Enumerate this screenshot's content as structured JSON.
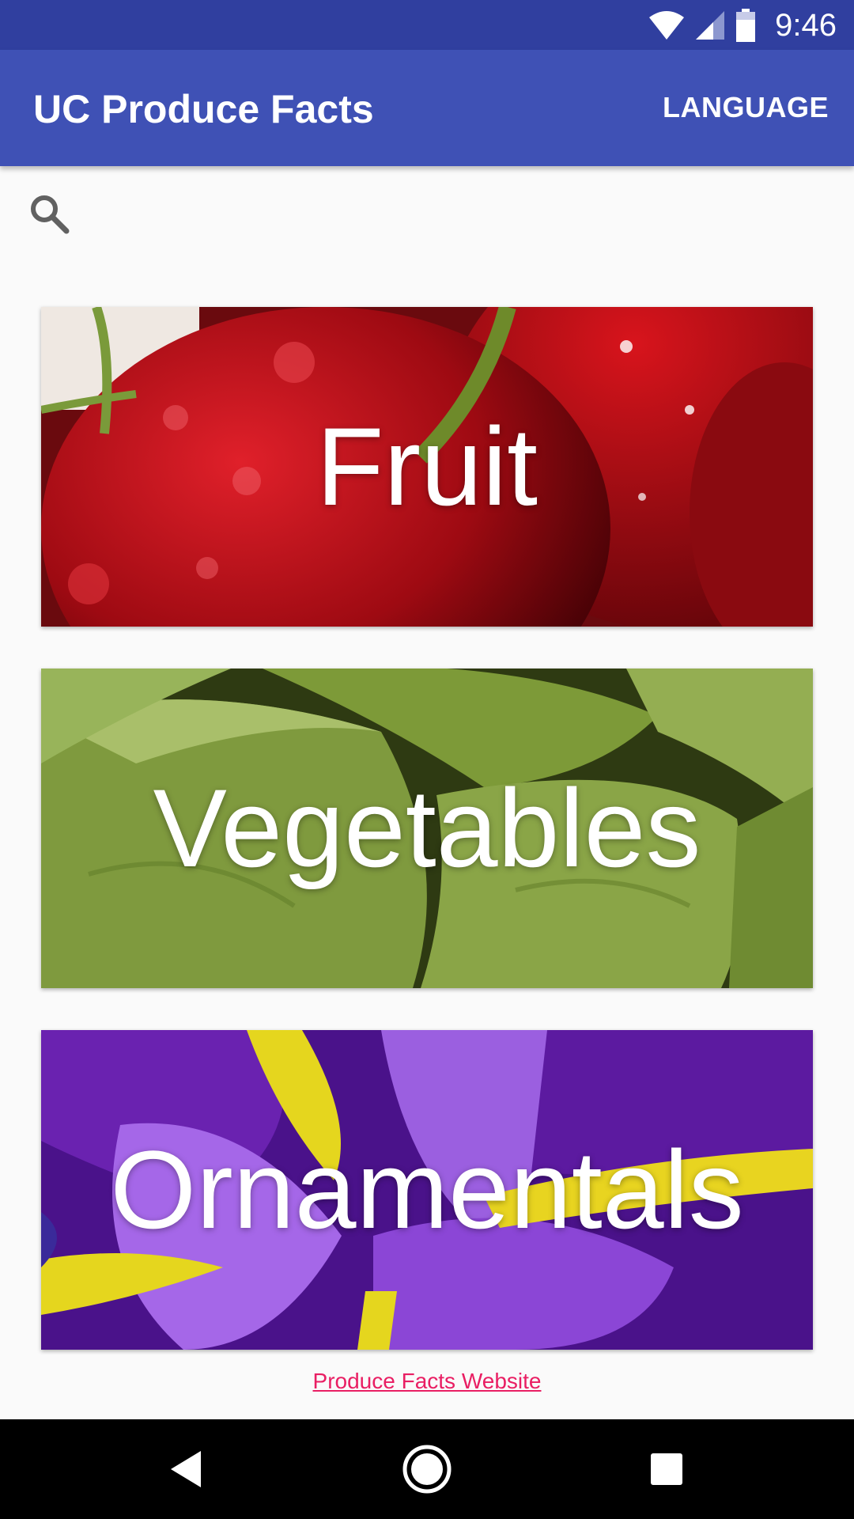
{
  "status_bar": {
    "time": "9:46",
    "icons": [
      "wifi-icon",
      "cell-signal-icon",
      "battery-icon"
    ]
  },
  "app_bar": {
    "title": "UC Produce Facts",
    "language_label": "LANGUAGE"
  },
  "search": {
    "icon": "search-icon"
  },
  "categories": [
    {
      "label": "Fruit"
    },
    {
      "label": "Vegetables"
    },
    {
      "label": "Ornamentals"
    }
  ],
  "footer": {
    "link_text": "Produce Facts Website"
  },
  "nav_bar": {
    "icons": [
      "back-icon",
      "home-icon",
      "recents-icon"
    ]
  },
  "colors": {
    "status_bar": "#303f9f",
    "app_bar": "#3f51b5",
    "link": "#e91e63",
    "background": "#fafafa"
  }
}
